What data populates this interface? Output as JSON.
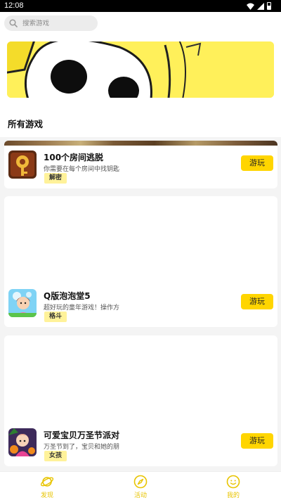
{
  "status_bar": {
    "time": "12:08"
  },
  "search": {
    "placeholder": "搜索游戏"
  },
  "section": {
    "title": "所有游戏"
  },
  "games": [
    {
      "title": "100个房间逃脱",
      "description": "你需要在每个房间中找钥匙",
      "tag": "解密",
      "button": "游玩"
    },
    {
      "title": "Q版泡泡堂5",
      "description": "超好玩的童年游戏！操作方",
      "tag": "格斗",
      "button": "游玩"
    },
    {
      "title": "可爱宝贝万圣节派对",
      "description": "万圣节到了，宝贝和她的朋",
      "tag": "女孩",
      "button": "游玩"
    }
  ],
  "tabs": [
    {
      "label": "发现",
      "icon": "planet-icon"
    },
    {
      "label": "活动",
      "icon": "compass-icon"
    },
    {
      "label": "我的",
      "icon": "smiley-icon"
    }
  ],
  "colors": {
    "accent": "#ffd500",
    "tag_bg": "#fff29a",
    "banner_bg": "#fff05a",
    "tab_active": "#e8c400"
  }
}
